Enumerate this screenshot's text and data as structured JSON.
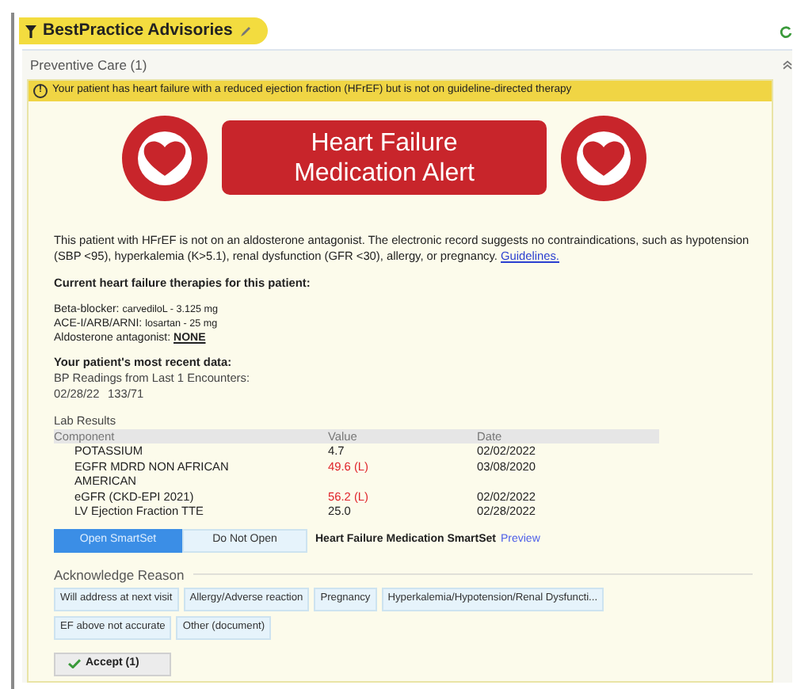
{
  "header": {
    "title": "BestPractice Advisories"
  },
  "section": {
    "title": "Preventive Care (1)"
  },
  "warning": {
    "icon": "!",
    "text": "Your patient has heart failure with a reduced ejection fraction (HFrEF) but is not on guideline-directed therapy"
  },
  "banner": {
    "lines": [
      "Heart Failure",
      "Medication Alert"
    ]
  },
  "message": {
    "text": "This patient with HFrEF is not on an aldosterone antagonist. The electronic record suggests no contraindications, such as hypotension (SBP <95), hyperkalemia (K>5.1), renal dysfunction (GFR <30), allergy, or pregnancy.",
    "link": "Guidelines."
  },
  "therapies": {
    "heading": "Current heart failure therapies for this patient:",
    "items": [
      {
        "label": "Beta-blocker:",
        "value": "carvediloL - 3.125 mg",
        "missing": false
      },
      {
        "label": "ACE-I/ARB/ARNI:",
        "value": "losartan - 25 mg",
        "missing": false
      },
      {
        "label": "Aldosterone antagonist:",
        "value": "NONE",
        "missing": true
      }
    ]
  },
  "recent": {
    "heading": "Your patient's most recent data:",
    "subheading": "BP Readings from Last 1 Encounters:",
    "readings": [
      {
        "date": "02/28/22",
        "value": "133/71"
      }
    ]
  },
  "labs": {
    "title": "Lab Results",
    "columns": [
      "Component",
      "Value",
      "Date"
    ],
    "rows": [
      {
        "component": "POTASSIUM",
        "value": "4.7",
        "date": "02/02/2022",
        "abnormal": false
      },
      {
        "component": "EGFR MDRD NON AFRICAN AMERICAN",
        "value": "49.6 (L)",
        "date": "03/08/2020",
        "abnormal": true
      },
      {
        "component": "eGFR (CKD-EPI 2021)",
        "value": "56.2 (L)",
        "date": "02/02/2022",
        "abnormal": true
      },
      {
        "component": "LV Ejection Fraction TTE",
        "value": "25.0",
        "date": "02/28/2022",
        "abnormal": false
      }
    ]
  },
  "smartset": {
    "options": [
      {
        "label": "Open SmartSet",
        "selected": true
      },
      {
        "label": "Do Not Open",
        "selected": false
      }
    ],
    "name": "Heart Failure Medication SmartSet",
    "link": "Preview"
  },
  "acknowledge": {
    "title": "Acknowledge Reason",
    "reasons": [
      {
        "label": "Will address at next visit",
        "selected": false
      },
      {
        "label": "Allergy/Adverse reaction",
        "selected": false
      },
      {
        "label": "Pregnancy",
        "selected": false
      },
      {
        "label": "Hyperkalemia/Hypotension/Renal Dysfuncti...",
        "selected": false
      },
      {
        "label": "EF above not accurate",
        "selected": false
      },
      {
        "label": "Other (document)",
        "selected": false
      }
    ]
  },
  "accept": {
    "label": "Accept (1)"
  }
}
